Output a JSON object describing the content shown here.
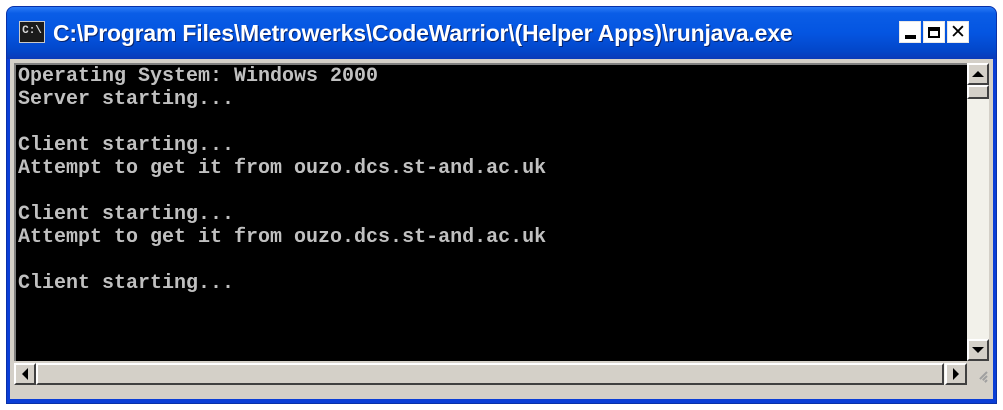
{
  "window": {
    "title": "C:\\Program Files\\Metrowerks\\CodeWarrior\\(Helper Apps)\\runjava.exe",
    "icon": "console-app-icon",
    "icon_text": "C:\\"
  },
  "title_buttons": {
    "minimize": "minimize-icon",
    "maximize": "maximize-icon",
    "close_glyph": "✕"
  },
  "console": {
    "lines": [
      "Operating System: Windows 2000",
      "Server starting...",
      "",
      "Client starting...",
      "Attempt to get it from ouzo.dcs.st-and.ac.uk",
      "",
      "Client starting...",
      "Attempt to get it from ouzo.dcs.st-and.ac.uk",
      "",
      "Client starting..."
    ],
    "background": "#000000",
    "foreground": "#c0c0c0"
  },
  "colors": {
    "titlebar": "#0a5de6",
    "frame": "#d4d0c8"
  }
}
